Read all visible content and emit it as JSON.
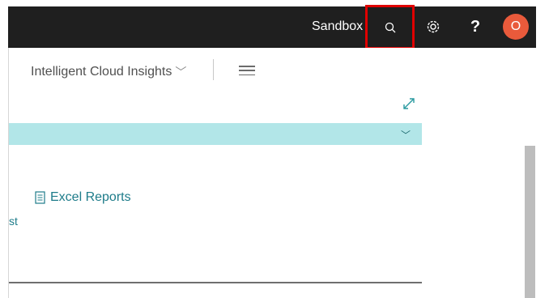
{
  "topbar": {
    "environment": "Sandbox",
    "icons": {
      "search": "search-icon",
      "settings": "gear-icon",
      "help": "help-icon"
    },
    "help_label": "?",
    "avatar_initial": "O",
    "avatar_color": "#e95a3b",
    "highlight_color": "#e00000"
  },
  "content": {
    "nav_menu_label": "Intelligent Cloud Insights",
    "section_bar_color": "#b2e6e8",
    "excel_reports_label": "Excel Reports",
    "clipped_label": "st"
  }
}
